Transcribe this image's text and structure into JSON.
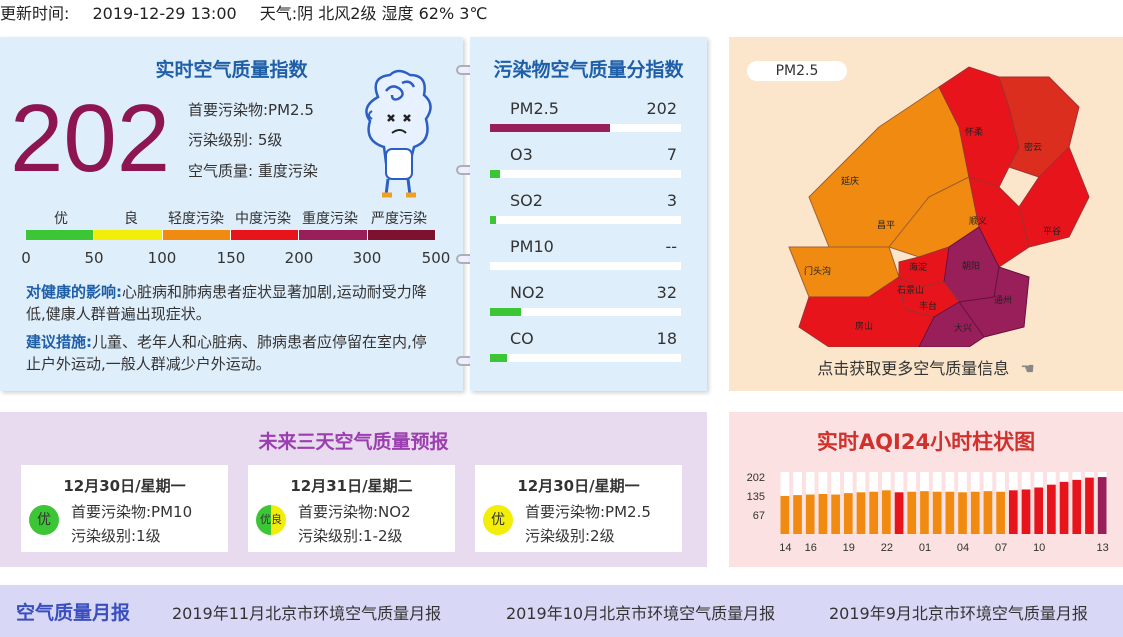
{
  "header": {
    "update_label": "更新时间:",
    "update_time": "2019-12-29 13:00",
    "weather": "天气:阴 北风2级 湿度 62% 3℃"
  },
  "aqi": {
    "title": "实时空气质量指数",
    "value": "202",
    "primary": "首要污染物:PM2.5",
    "level": "污染级别:  5级",
    "quality": "空气质量:  重度污染",
    "scale_labels": [
      "优",
      "良",
      "轻度污染",
      "中度污染",
      "重度污染",
      "严度污染"
    ],
    "scale_numbers": [
      "0",
      "50",
      "100",
      "150",
      "200",
      "300",
      "500"
    ],
    "scale_colors": [
      "#3cc635",
      "#f2ee0a",
      "#f08a10",
      "#e8141b",
      "#991f5a",
      "#7d1230"
    ],
    "health_label": "对健康的影响:",
    "health_text": "心脏病和肺病患者症状显著加剧,运动耐受力降低,健康人群普遍出现症状。",
    "advice_label": "建议措施:",
    "advice_text": "儿童、老年人和心脏病、肺病患者应停留在室内,停止户外运动,一般人群减少户外运动。"
  },
  "pollutants": {
    "title": "污染物空气质量分指数",
    "items": [
      {
        "name": "PM2.5",
        "value": "202",
        "fill": 0.63,
        "color": "#991f5a"
      },
      {
        "name": "O3",
        "value": "7",
        "fill": 0.05,
        "color": "#3cc635"
      },
      {
        "name": "SO2",
        "value": "3",
        "fill": 0.03,
        "color": "#3cc635"
      },
      {
        "name": "PM10",
        "value": "--",
        "fill": 0,
        "color": "#3cc635"
      },
      {
        "name": "NO2",
        "value": "32",
        "fill": 0.16,
        "color": "#3cc635"
      },
      {
        "name": "CO",
        "value": "18",
        "fill": 0.09,
        "color": "#3cc635"
      }
    ]
  },
  "map": {
    "tag": "PM2.5",
    "link": "点击获取更多空气质量信息",
    "districts": [
      "延庆",
      "怀柔",
      "密云",
      "昌平",
      "顺义",
      "平谷",
      "门头沟",
      "海淀",
      "朝阳",
      "石景山",
      "通州",
      "丰台",
      "房山",
      "大兴"
    ]
  },
  "forecast": {
    "title": "未来三天空气质量预报",
    "days": [
      {
        "date": "12月30日/星期一",
        "badge": "优",
        "primary": "首要污染物:PM10",
        "level": "污染级别:1级"
      },
      {
        "date": "12月31日/星期二",
        "badge": "优良",
        "primary": "首要污染物:NO2",
        "level": "污染级别:1-2级"
      },
      {
        "date": "12月30日/星期一",
        "badge": "优",
        "primary": "首要污染物:PM2.5",
        "level": "污染级别:2级"
      }
    ]
  },
  "chart_data": {
    "type": "bar",
    "title": "实时AQI24小时柱状图",
    "yticks": [
      "202",
      "135",
      "67"
    ],
    "xticks": [
      "14",
      "16",
      "19",
      "22",
      "01",
      "04",
      "07",
      "10",
      "13"
    ],
    "values": [
      135,
      138,
      140,
      142,
      140,
      145,
      148,
      150,
      155,
      148,
      150,
      152,
      150,
      150,
      148,
      150,
      152,
      150,
      155,
      158,
      165,
      175,
      185,
      192,
      200,
      202
    ],
    "colors": [
      "#f08a10",
      "#f08a10",
      "#f08a10",
      "#f08a10",
      "#f08a10",
      "#f08a10",
      "#f08a10",
      "#f08a10",
      "#f08a10",
      "#e8141b",
      "#f08a10",
      "#f08a10",
      "#f08a10",
      "#f08a10",
      "#f08a10",
      "#f08a10",
      "#f08a10",
      "#f08a10",
      "#e8141b",
      "#e8141b",
      "#e8141b",
      "#e8141b",
      "#e8141b",
      "#e8141b",
      "#e8141b",
      "#991f5a"
    ]
  },
  "monthly": {
    "title": "空气质量月报",
    "links": [
      "2019年11月北京市环境空气质量月报",
      "2019年10月北京市环境空气质量月报",
      "2019年9月北京市环境空气质量月报"
    ]
  }
}
